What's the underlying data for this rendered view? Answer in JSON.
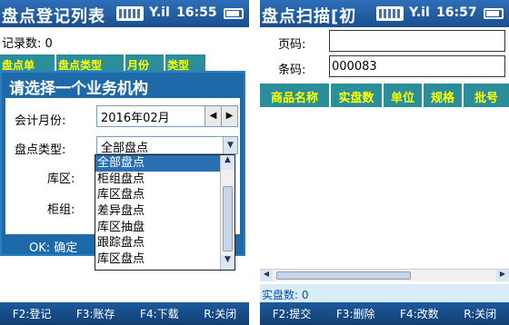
{
  "left": {
    "title": "盘点登记列表",
    "status": {
      "signal": "Y.il",
      "time": "16:55"
    },
    "record_count": "记录数: 0",
    "columns": [
      "盘点单",
      "盘点类型",
      "月份",
      "类型"
    ],
    "dialog": {
      "title": "请选择一个业务机构",
      "month_label": "会计月份:",
      "month_value": "2016年02月",
      "type_label": "盘点类型:",
      "type_value": "全部盘点",
      "warehouse_label": "库区:",
      "cabinet_label": "柜组:",
      "ok_label": "OK: 确定",
      "options": [
        "全部盘点",
        "柜组盘点",
        "库区盘点",
        "差异盘点",
        "库区抽盘",
        "跟踪盘点",
        "库区盘点"
      ],
      "selected_index": 0
    },
    "bottom": [
      "F2:登记",
      "F3:账存",
      "F4:下载",
      "R:关闭"
    ]
  },
  "right": {
    "title": "盘点扫描[初",
    "status": {
      "signal": "Y.il",
      "time": "16:57"
    },
    "page_label": "页码:",
    "page_value": "",
    "barcode_label": "条码:",
    "barcode_value": "000083",
    "columns": [
      "商品名称",
      "实盘数",
      "单位",
      "规格",
      "批号"
    ],
    "count_text": "实盘数: 0",
    "bottom": [
      "F2:提交",
      "F3:删除",
      "F4:改数",
      "R:关闭"
    ]
  },
  "colors": {
    "titlebar": "#1a4f8f",
    "header": "#2a8f9a",
    "header_text": "#ffff00",
    "selection": "#2b6fb4"
  }
}
